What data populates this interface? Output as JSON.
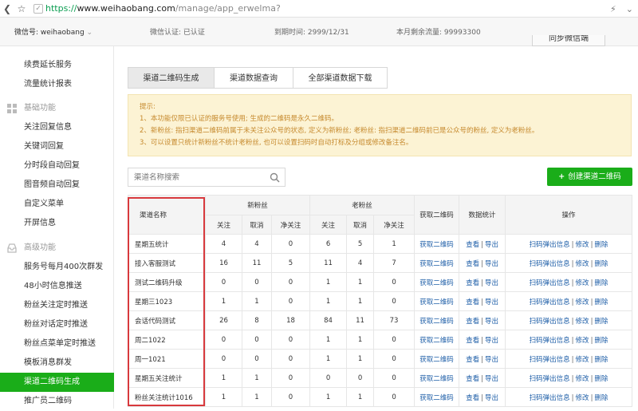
{
  "browser": {
    "url_secure": "https://",
    "url_host": "www.weihaobang.com",
    "url_path": "/manage/app_erwelma?"
  },
  "account": {
    "wechat_id": "微信号: weihaobang",
    "auth": "微信认证: 已认证",
    "expire": "到期时间: 2999/12/31",
    "traffic": "本月剩余流量: 99993300",
    "sync_button": "同步微信端"
  },
  "sidebar": {
    "top_items": [
      {
        "label": "续费延长服务"
      },
      {
        "label": "流量统计报表"
      }
    ],
    "group_basic": "基础功能",
    "basic_items": [
      {
        "label": "关注回复信息"
      },
      {
        "label": "关键词回复"
      },
      {
        "label": "分时段自动回复"
      },
      {
        "label": "图音频自动回复"
      },
      {
        "label": "自定义菜单"
      },
      {
        "label": "开屏信息"
      }
    ],
    "group_advanced": "高级功能",
    "advanced_items": [
      {
        "label": "服务号每月400次群发"
      },
      {
        "label": "48小时信息推送"
      },
      {
        "label": "粉丝关注定时推送"
      },
      {
        "label": "粉丝对话定时推送"
      },
      {
        "label": "粉丝点菜单定时推送"
      },
      {
        "label": "模板消息群发"
      },
      {
        "label": "渠道二维码生成"
      },
      {
        "label": "推广员二维码"
      }
    ]
  },
  "tabs": [
    {
      "label": "渠道二维码生成"
    },
    {
      "label": "渠道数据查询"
    },
    {
      "label": "全部渠道数据下载"
    }
  ],
  "notice": {
    "title": "提示:",
    "lines": [
      "1、本功能仅限已认证的服务号使用; 生成的二维码是永久二维码。",
      "2、新粉丝: 指扫渠道二维码前属于未关注公众号的状态, 定义为新粉丝; 老粉丝: 指扫渠道二维码前已是公众号的粉丝, 定义为老粉丝。",
      "3、可以设置只统计新粉丝不统计老粉丝, 也可以设置扫码时自动打标及分组或修改备注名。"
    ]
  },
  "search": {
    "placeholder": "渠道名称搜索"
  },
  "create_button": "创建渠道二维码",
  "table": {
    "h_name": "渠道名称",
    "h_new": "新粉丝",
    "h_old": "老粉丝",
    "h_get": "获取二维码",
    "h_stats": "数据统计",
    "h_ops": "操作",
    "sub": [
      "关注",
      "取消",
      "净关注",
      "关注",
      "取消",
      "净关注"
    ],
    "link_get": "获取二维码",
    "link_view": "查看",
    "link_export": "导出",
    "link_popup": "扫码弹出信息",
    "link_edit": "修改",
    "link_delete": "删除",
    "pipe": "|",
    "rows": [
      {
        "name": "星期五统计",
        "v": [
          "4",
          "4",
          "0",
          "6",
          "5",
          "1"
        ]
      },
      {
        "name": "接入客服测试",
        "v": [
          "16",
          "11",
          "5",
          "11",
          "4",
          "7"
        ]
      },
      {
        "name": "测试二维码升级",
        "v": [
          "0",
          "0",
          "0",
          "1",
          "1",
          "0"
        ]
      },
      {
        "name": "星期三1023",
        "v": [
          "1",
          "1",
          "0",
          "1",
          "1",
          "0"
        ]
      },
      {
        "name": "会话代码测试",
        "v": [
          "26",
          "8",
          "18",
          "84",
          "11",
          "73"
        ]
      },
      {
        "name": "周二1022",
        "v": [
          "0",
          "0",
          "0",
          "1",
          "1",
          "0"
        ]
      },
      {
        "name": "周一1021",
        "v": [
          "0",
          "0",
          "0",
          "1",
          "1",
          "0"
        ]
      },
      {
        "name": "星期五关注统计",
        "v": [
          "1",
          "1",
          "0",
          "0",
          "0",
          "0"
        ]
      },
      {
        "name": "粉丝关注统计1016",
        "v": [
          "1",
          "1",
          "0",
          "1",
          "1",
          "0"
        ]
      }
    ]
  },
  "colors": {
    "accent": "#1aad19",
    "link": "#1f5fa8",
    "highlight_box": "#d8393d",
    "notice_text": "#c68a2e"
  }
}
